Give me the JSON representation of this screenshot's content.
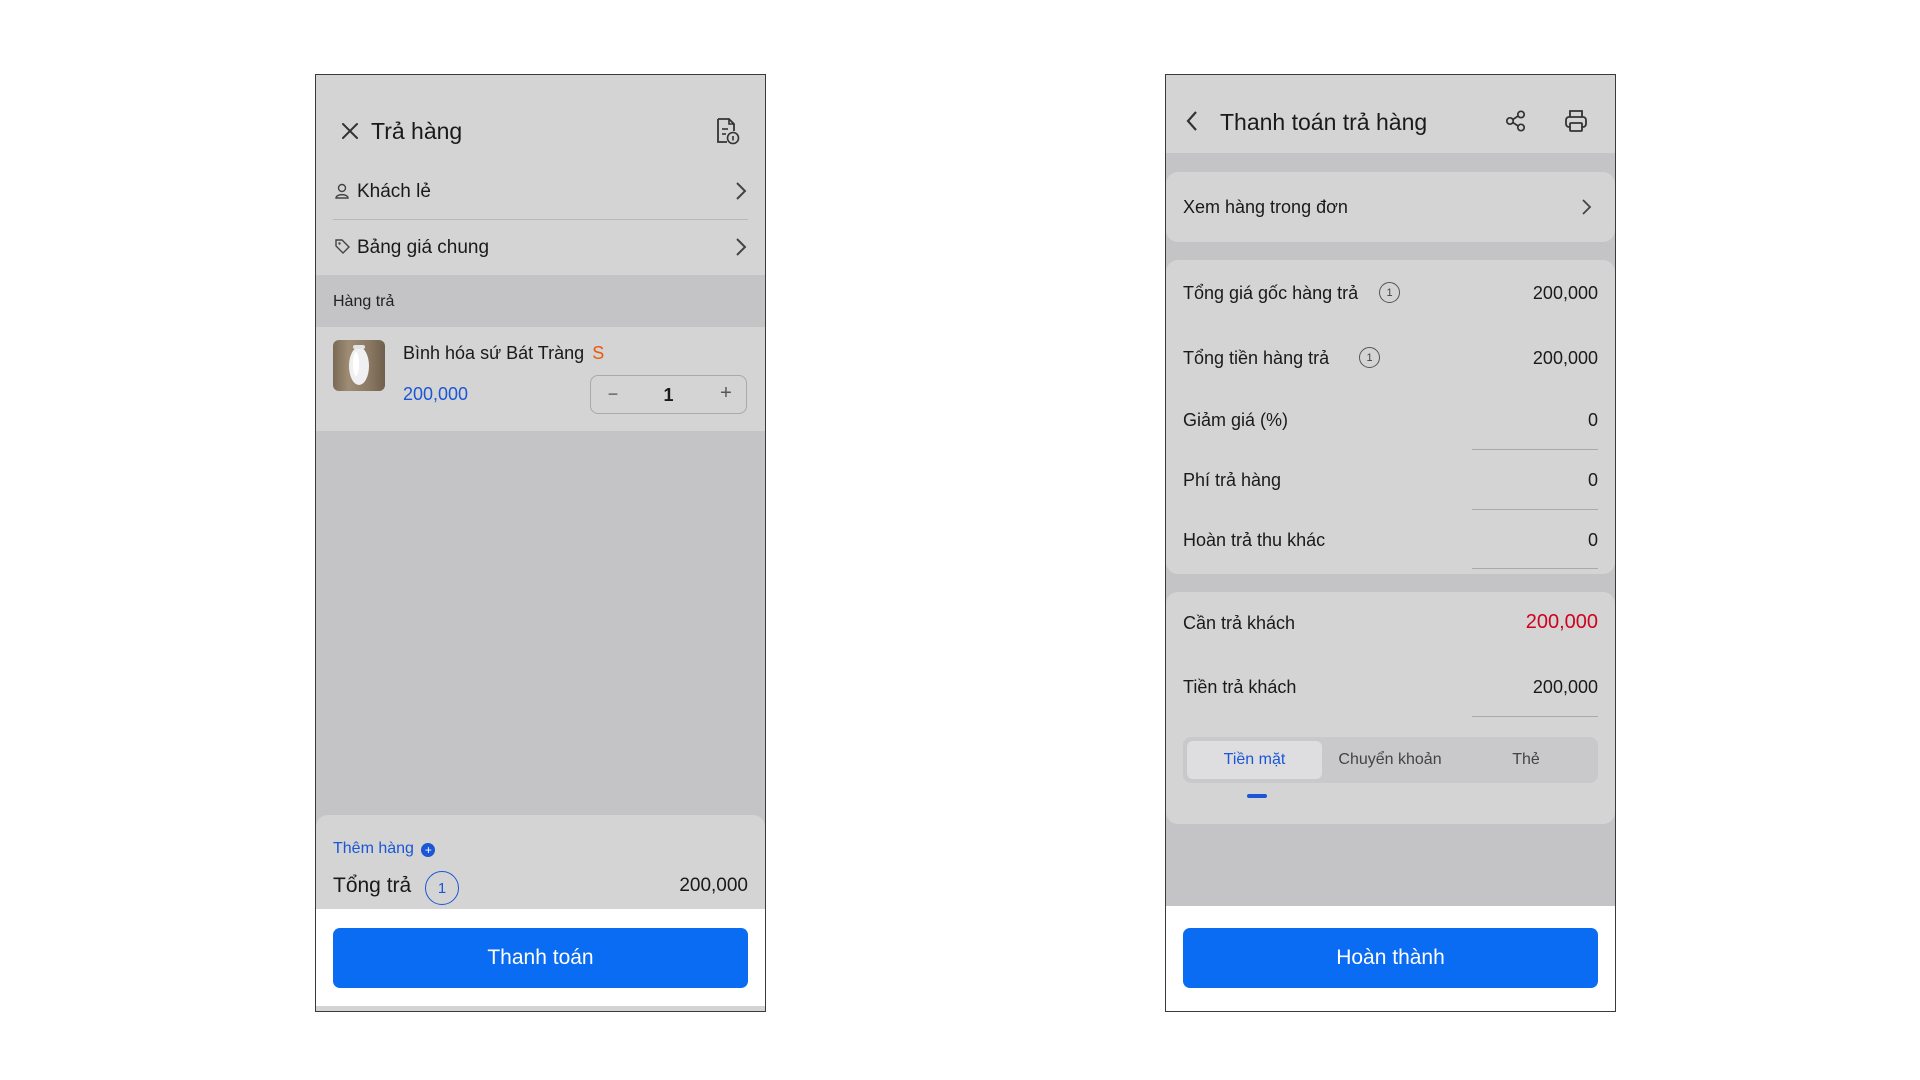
{
  "left": {
    "header": {
      "title": "Trả hàng",
      "close_icon": "close-icon",
      "doc_icon": "document-info-icon"
    },
    "customer": {
      "label": "Khách lẻ",
      "icon": "person-icon"
    },
    "price_list": {
      "label": "Bảng giá chung",
      "icon": "tag-icon"
    },
    "section_label": "Hàng trả",
    "item": {
      "name": "Bình hóa sứ Bát Tràng",
      "tag": "S",
      "price": "200,000",
      "quantity": "1"
    },
    "add_items": {
      "label": "Thêm hàng"
    },
    "total": {
      "label": "Tổng trả",
      "count": "1",
      "value": "200,000"
    },
    "pay_button": "Thanh toán"
  },
  "right": {
    "header": {
      "title": "Thanh toán trả hàng",
      "back_icon": "chevron-left-icon",
      "share_icon": "share-icon",
      "print_icon": "printer-icon"
    },
    "view_items": "Xem hàng trong đơn",
    "rows": [
      {
        "label": "Tổng giá gốc hàng trả",
        "value": "200,000",
        "info": "1"
      },
      {
        "label": "Tổng tiền hàng trả",
        "value": "200,000",
        "info": "1"
      },
      {
        "label": "Giảm giá (%)",
        "value": "0"
      },
      {
        "label": "Phí trả hàng",
        "value": "0"
      },
      {
        "label": "Hoàn trả thu khác",
        "value": "0"
      }
    ],
    "refund_due": {
      "label": "Cần trả khách",
      "value": "200,000"
    },
    "refund_paid": {
      "label": "Tiền trả khách",
      "value": "200,000"
    },
    "payment_methods": [
      "Tiền mặt",
      "Chuyển khoản",
      "Thẻ"
    ],
    "complete_button": "Hoàn thành"
  },
  "colors": {
    "accent": "#0a6cf2",
    "link_blue": "#1a56d6",
    "danger_red": "#d0021b",
    "orange_tag": "#e8590c",
    "overlay_gray": "#c4c4c6",
    "card_gray": "#d4d4d5"
  }
}
